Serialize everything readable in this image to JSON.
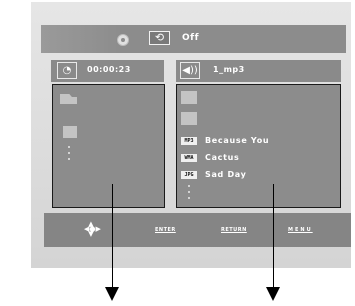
{
  "top_bar": {
    "repeat_icon": "repeat-icon",
    "repeat_value": "Off"
  },
  "left_panel": {
    "timer_icon": "clock-icon",
    "time": "00:00:23"
  },
  "right_panel": {
    "speaker_icon": "speaker-icon",
    "track": "1_mp3",
    "files": [
      {
        "type": "MP3",
        "name": "Because You"
      },
      {
        "type": "WMA",
        "name": "Cactus"
      },
      {
        "type": "JPG",
        "name": "Sad Day"
      }
    ]
  },
  "bottom_bar": {
    "nav_icon": "navigation-icon",
    "enter_label": "ENTER",
    "return_label": "RETURN",
    "menu_label": "MENU"
  },
  "colors": {
    "panel_bg": "#dadada",
    "bar_gray": "#8a8a8a",
    "text_white": "#ffffff"
  }
}
